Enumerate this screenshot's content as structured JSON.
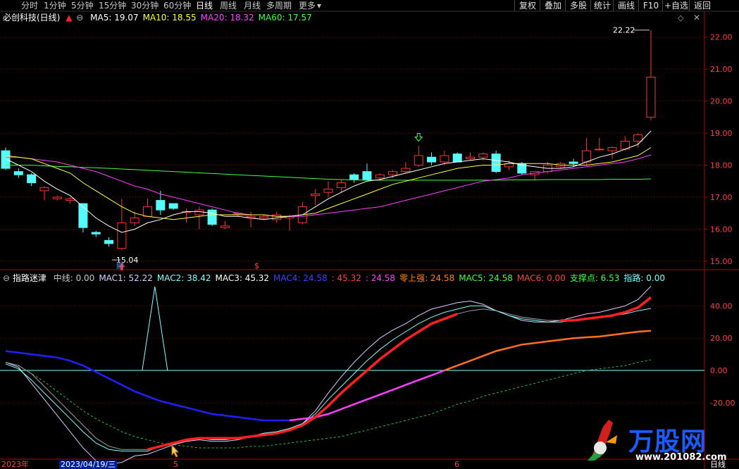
{
  "toolbar": {
    "periods": [
      {
        "label": "分时"
      },
      {
        "label": "1分钟"
      },
      {
        "label": "5分钟"
      },
      {
        "label": "15分钟"
      },
      {
        "label": "30分钟"
      },
      {
        "label": "60分钟"
      },
      {
        "label": "日线",
        "active": true
      },
      {
        "label": "周线"
      },
      {
        "label": "月线"
      },
      {
        "label": "多周期"
      },
      {
        "label": "更多"
      }
    ],
    "more_arrow": "▾",
    "right_buttons": [
      {
        "label": "复权"
      },
      {
        "label": "叠加"
      },
      {
        "label": "多股"
      },
      {
        "label": "统计"
      },
      {
        "label": "画线"
      },
      {
        "label": "F10"
      },
      {
        "label": "+自选"
      },
      {
        "label": "返回"
      }
    ]
  },
  "main_legend": {
    "title": "必创科技(日线)",
    "items": [
      {
        "label": "MA5: 19.07",
        "color": "#ffffff"
      },
      {
        "label": "MA10: 18.55",
        "color": "#ffff40"
      },
      {
        "label": "MA20: 18.32",
        "color": "#ff40ff"
      },
      {
        "label": "MA60: 17.57",
        "color": "#40ff40"
      }
    ]
  },
  "main_axis": [
    "22.00",
    "21.00",
    "20.00",
    "19.00",
    "18.00",
    "17.00",
    "16.00",
    "15.00"
  ],
  "price_annotations": {
    "high": "22.22",
    "low": "15.04",
    "finance_tag": "财",
    "dollar_tag": "$"
  },
  "sub_legend": {
    "title": "指路迷津",
    "items": [
      {
        "label": "中线: 0.00",
        "color": "#c8c8c8"
      },
      {
        "label": "MAC1: 52.22",
        "color": "#e0c8ff"
      },
      {
        "label": "MAC2: 38.42",
        "color": "#80ffff"
      },
      {
        "label": "MAC3: 45.32",
        "color": "#ffffff"
      },
      {
        "label": "MAC4: 24.58",
        "color": "#4040ff"
      },
      {
        "label": ": 45.32",
        "color": "#ff4040"
      },
      {
        "label": ": 24.58",
        "color": "#ff40ff"
      },
      {
        "label": "零上强: 24.58",
        "color": "#ff8020"
      },
      {
        "label": "MAC5: 24.58",
        "color": "#40ff40"
      },
      {
        "label": "MAC6: 0.00",
        "color": "#ff4040"
      },
      {
        "label": "支撑点: 6.53",
        "color": "#40ff40"
      },
      {
        "label": "指路: 0.00",
        "color": "#80ffff"
      }
    ]
  },
  "sub_axis": [
    "40.00",
    "20.00",
    "0.00",
    "-20.00"
  ],
  "time_axis": {
    "year": "2023年",
    "cursor_date": "2023/04/19/三",
    "month5": "5",
    "month6": "6",
    "mode": "日线"
  },
  "watermark": {
    "brand": "万股网",
    "url": "www.201082.com"
  },
  "chart_data": {
    "type": "candlestick",
    "title": "必创科技(日线)",
    "ohlc": [
      [
        18.45,
        18.55,
        17.85,
        17.9
      ],
      [
        17.8,
        17.9,
        17.6,
        17.7
      ],
      [
        17.7,
        17.75,
        17.35,
        17.45
      ],
      [
        17.2,
        17.35,
        16.9,
        17.3
      ],
      [
        16.95,
        17.05,
        16.9,
        17.0
      ],
      [
        16.9,
        17.0,
        16.8,
        16.95
      ],
      [
        16.8,
        16.8,
        15.9,
        16.05
      ],
      [
        15.9,
        15.95,
        15.75,
        15.85
      ],
      [
        15.65,
        15.75,
        15.45,
        15.55
      ],
      [
        15.4,
        16.95,
        15.35,
        16.2
      ],
      [
        16.2,
        16.55,
        16.1,
        16.35
      ],
      [
        16.4,
        16.95,
        16.4,
        16.7
      ],
      [
        16.9,
        17.2,
        16.45,
        16.6
      ],
      [
        16.8,
        16.8,
        16.6,
        16.65
      ],
      [
        16.55,
        16.65,
        16.2,
        16.55
      ],
      [
        16.45,
        16.7,
        16.0,
        16.6
      ],
      [
        16.6,
        16.65,
        16.1,
        16.15
      ],
      [
        16.05,
        16.25,
        16.0,
        16.1
      ],
      [
        16.5,
        16.55,
        16.4,
        16.5
      ],
      [
        16.35,
        16.55,
        16.05,
        16.4
      ],
      [
        16.35,
        16.45,
        16.3,
        16.4
      ],
      [
        16.3,
        16.55,
        16.2,
        16.45
      ],
      [
        16.35,
        16.45,
        15.95,
        16.4
      ],
      [
        16.2,
        16.85,
        16.15,
        16.7
      ],
      [
        17.05,
        17.25,
        16.75,
        17.1
      ],
      [
        17.15,
        17.5,
        17.0,
        17.25
      ],
      [
        17.3,
        17.55,
        17.15,
        17.45
      ],
      [
        17.7,
        17.75,
        17.45,
        17.55
      ],
      [
        17.8,
        18.05,
        17.6,
        17.55
      ],
      [
        17.6,
        17.75,
        17.5,
        17.7
      ],
      [
        17.7,
        17.85,
        17.6,
        17.8
      ],
      [
        17.8,
        18.1,
        17.75,
        17.9
      ],
      [
        18.0,
        18.6,
        17.95,
        18.3
      ],
      [
        18.25,
        18.4,
        18.0,
        18.1
      ],
      [
        18.1,
        18.45,
        18.0,
        18.3
      ],
      [
        18.35,
        18.4,
        18.1,
        18.1
      ],
      [
        18.2,
        18.4,
        18.15,
        18.25
      ],
      [
        18.25,
        18.4,
        18.15,
        18.35
      ],
      [
        18.35,
        18.45,
        17.75,
        17.8
      ],
      [
        17.95,
        18.15,
        17.85,
        18.05
      ],
      [
        18.05,
        18.1,
        17.7,
        17.75
      ],
      [
        17.7,
        17.8,
        17.55,
        17.8
      ],
      [
        17.8,
        18.1,
        17.75,
        18.0
      ],
      [
        17.95,
        18.1,
        17.9,
        18.05
      ],
      [
        18.1,
        18.2,
        17.95,
        18.05
      ],
      [
        18.1,
        18.85,
        18.0,
        18.45
      ],
      [
        18.5,
        18.85,
        18.45,
        18.5
      ],
      [
        18.45,
        18.6,
        18.2,
        18.55
      ],
      [
        18.5,
        18.9,
        18.45,
        18.75
      ],
      [
        18.75,
        19.0,
        18.55,
        18.95
      ],
      [
        19.5,
        22.22,
        19.4,
        20.75
      ]
    ],
    "ma5": [
      18.2,
      18.0,
      17.8,
      17.5,
      17.25,
      17.05,
      16.7,
      16.35,
      16.1,
      15.9,
      16.0,
      16.2,
      16.3,
      16.45,
      16.55,
      16.55,
      16.5,
      16.4,
      16.4,
      16.35,
      16.3,
      16.35,
      16.4,
      16.45,
      16.7,
      16.95,
      17.15,
      17.35,
      17.5,
      17.55,
      17.65,
      17.75,
      17.85,
      17.95,
      18.05,
      18.1,
      18.15,
      18.2,
      18.15,
      18.1,
      18.0,
      17.95,
      17.9,
      17.9,
      17.95,
      18.1,
      18.25,
      18.35,
      18.5,
      18.65,
      19.07
    ],
    "ma10": [
      18.3,
      18.25,
      18.2,
      18.05,
      17.9,
      17.75,
      17.45,
      17.2,
      16.95,
      16.7,
      16.5,
      16.4,
      16.35,
      16.3,
      16.35,
      16.4,
      16.45,
      16.45,
      16.45,
      16.45,
      16.45,
      16.4,
      16.4,
      16.45,
      16.5,
      16.65,
      16.8,
      16.95,
      17.1,
      17.25,
      17.4,
      17.5,
      17.6,
      17.7,
      17.8,
      17.9,
      17.95,
      18.0,
      18.0,
      18.05,
      18.05,
      18.05,
      18.05,
      18.0,
      18.0,
      18.0,
      18.05,
      18.1,
      18.2,
      18.3,
      18.55
    ],
    "ma20": [
      18.25,
      18.25,
      18.2,
      18.15,
      18.1,
      18.0,
      17.9,
      17.8,
      17.65,
      17.5,
      17.35,
      17.25,
      17.1,
      17.0,
      16.9,
      16.8,
      16.7,
      16.6,
      16.5,
      16.45,
      16.45,
      16.4,
      16.4,
      16.4,
      16.45,
      16.5,
      16.55,
      16.6,
      16.65,
      16.7,
      16.8,
      16.9,
      17.0,
      17.1,
      17.2,
      17.3,
      17.4,
      17.5,
      17.55,
      17.6,
      17.7,
      17.75,
      17.8,
      17.85,
      17.9,
      17.95,
      18.0,
      18.05,
      18.1,
      18.2,
      18.32
    ],
    "ma60": [
      18.0,
      18.0,
      18.0,
      17.98,
      17.96,
      17.95,
      17.93,
      17.92,
      17.9,
      17.88,
      17.86,
      17.84,
      17.82,
      17.8,
      17.78,
      17.76,
      17.74,
      17.72,
      17.7,
      17.68,
      17.66,
      17.64,
      17.62,
      17.6,
      17.58,
      17.56,
      17.55,
      17.54,
      17.53,
      17.53,
      17.53,
      17.53,
      17.53,
      17.53,
      17.53,
      17.53,
      17.53,
      17.53,
      17.53,
      17.54,
      17.54,
      17.54,
      17.55,
      17.55,
      17.55,
      17.55,
      17.55,
      17.56,
      17.56,
      17.56,
      17.57
    ],
    "indicator": {
      "mac1": [
        5,
        2,
        -8,
        -18,
        -28,
        -38,
        -48,
        -56,
        -58,
        -57,
        -53,
        -52,
        -49,
        -46,
        -44,
        -43,
        -44,
        -44,
        -43,
        -41,
        -39,
        -38,
        -36,
        -33,
        -25,
        -14,
        -4,
        5,
        13,
        20,
        25,
        29,
        34,
        38,
        40,
        42,
        43,
        41,
        37,
        34,
        31,
        30,
        30,
        31,
        33,
        35,
        36,
        38,
        40,
        44,
        52.22
      ],
      "mac2": [
        4,
        1,
        -6,
        -14,
        -22,
        -30,
        -38,
        -45,
        -49,
        -50,
        -50,
        -50,
        -47,
        -45,
        -43,
        -42,
        -43,
        -43,
        -42,
        -41,
        -39,
        -38,
        -36,
        -33,
        -27,
        -18,
        -10,
        -2,
        6,
        13,
        19,
        24,
        29,
        33,
        36,
        38,
        40,
        40,
        37,
        34,
        32,
        31,
        30,
        30,
        31,
        32,
        33,
        34,
        35,
        37,
        38.42
      ],
      "mac3": [
        5,
        3,
        -2,
        -10,
        -18,
        -26,
        -34,
        -42,
        -47,
        -49,
        -49,
        -49,
        -47,
        -45,
        -43,
        -42,
        -42,
        -42,
        -42,
        -41,
        -40,
        -39,
        -37,
        -34,
        -29,
        -22,
        -14,
        -7,
        0,
        7,
        13,
        19,
        24,
        29,
        32,
        35,
        37,
        38,
        37,
        35,
        33,
        32,
        31,
        31,
        31,
        32,
        33,
        34,
        36,
        39,
        45.32
      ],
      "mac4": [
        12,
        11,
        10,
        9,
        8,
        6,
        3,
        -1,
        -5,
        -9,
        -13,
        -16,
        -19,
        -21,
        -23,
        -25,
        -27,
        -28,
        -29,
        -30,
        -31,
        -31,
        -31,
        -30,
        -29,
        -27,
        -24,
        -21,
        -18,
        -15,
        -12,
        -9,
        -6,
        -3,
        0,
        3,
        6,
        9,
        12,
        14,
        16,
        17,
        18,
        19,
        20,
        20.5,
        21,
        22,
        23,
        24,
        24.58
      ],
      "mac5": [
        5,
        3,
        -2,
        -7,
        -13,
        -19,
        -25,
        -30,
        -34,
        -38,
        -41,
        -43,
        -45,
        -46,
        -47,
        -48,
        -48,
        -48,
        -48,
        -47,
        -47,
        -46,
        -45,
        -44,
        -43,
        -42,
        -41,
        -39,
        -37,
        -35,
        -33,
        -31,
        -29,
        -27,
        -24,
        -21,
        -19,
        -16,
        -14,
        -12,
        -10,
        -8,
        -6,
        -4,
        -2,
        0,
        1,
        2,
        3,
        5,
        6.53
      ],
      "signal_spike": {
        "index": 12,
        "value": 52
      }
    },
    "main_ylim": [
      14.8,
      22.5
    ],
    "sub_ylim": [
      -55,
      55
    ]
  }
}
